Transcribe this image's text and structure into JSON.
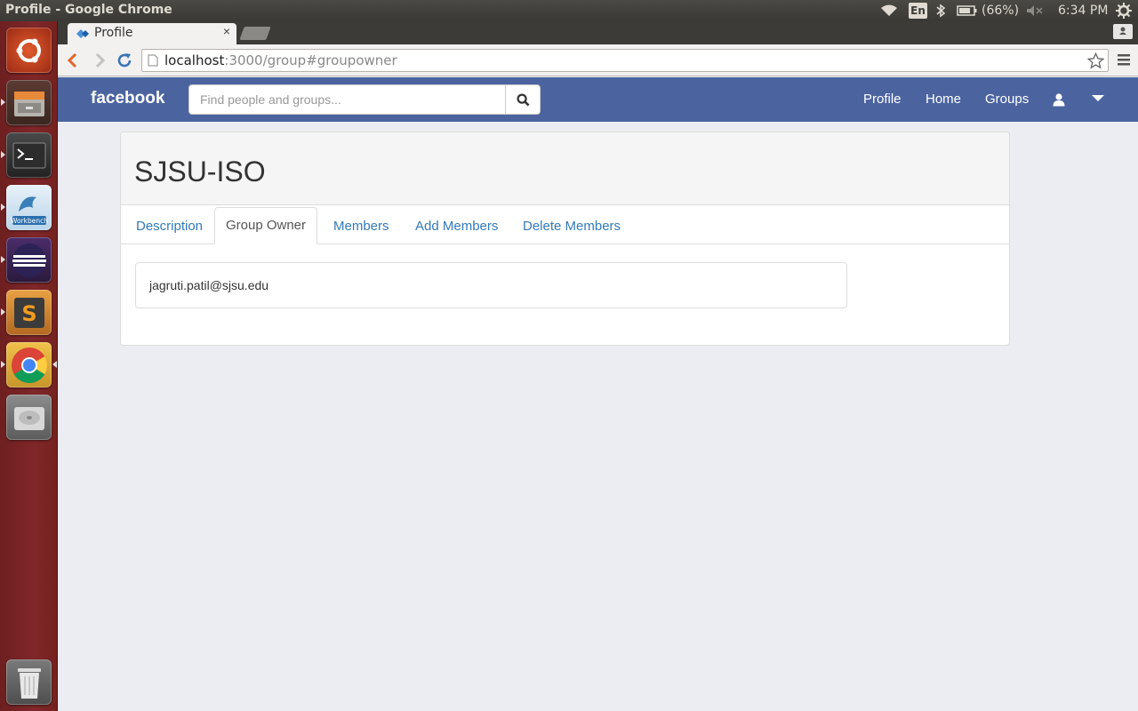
{
  "system": {
    "window_title": "Profile - Google Chrome",
    "keyboard_layout": "En",
    "battery": "(66%)",
    "clock": "6:34 PM"
  },
  "launcher": {
    "items": [
      "ubuntu-dash-icon",
      "files-icon",
      "terminal-icon",
      "mysql-workbench-icon",
      "eclipse-icon",
      "sublime-text-icon",
      "chrome-icon",
      "disk-icon",
      "trash-icon"
    ],
    "workbench_label": "Workbench",
    "sublime_glyph": "S"
  },
  "browser": {
    "tab_title": "Profile",
    "tab_close": "×",
    "url_host": "localhost",
    "url_path": ":3000/group#groupowner"
  },
  "navbar": {
    "brand": "facebook",
    "search_placeholder": "Find people and groups...",
    "links": [
      "Profile",
      "Home",
      "Groups"
    ]
  },
  "group": {
    "title": "SJSU-ISO",
    "tabs": [
      "Description",
      "Group Owner",
      "Members",
      "Add Members",
      "Delete Members"
    ],
    "active_tab": "Group Owner",
    "owner_email": "jagruti.patil@sjsu.edu"
  },
  "colors": {
    "navbar": "#4b64a0",
    "link": "#337ab7",
    "page_bg": "#ecedf2",
    "launcher": "#80272a"
  }
}
